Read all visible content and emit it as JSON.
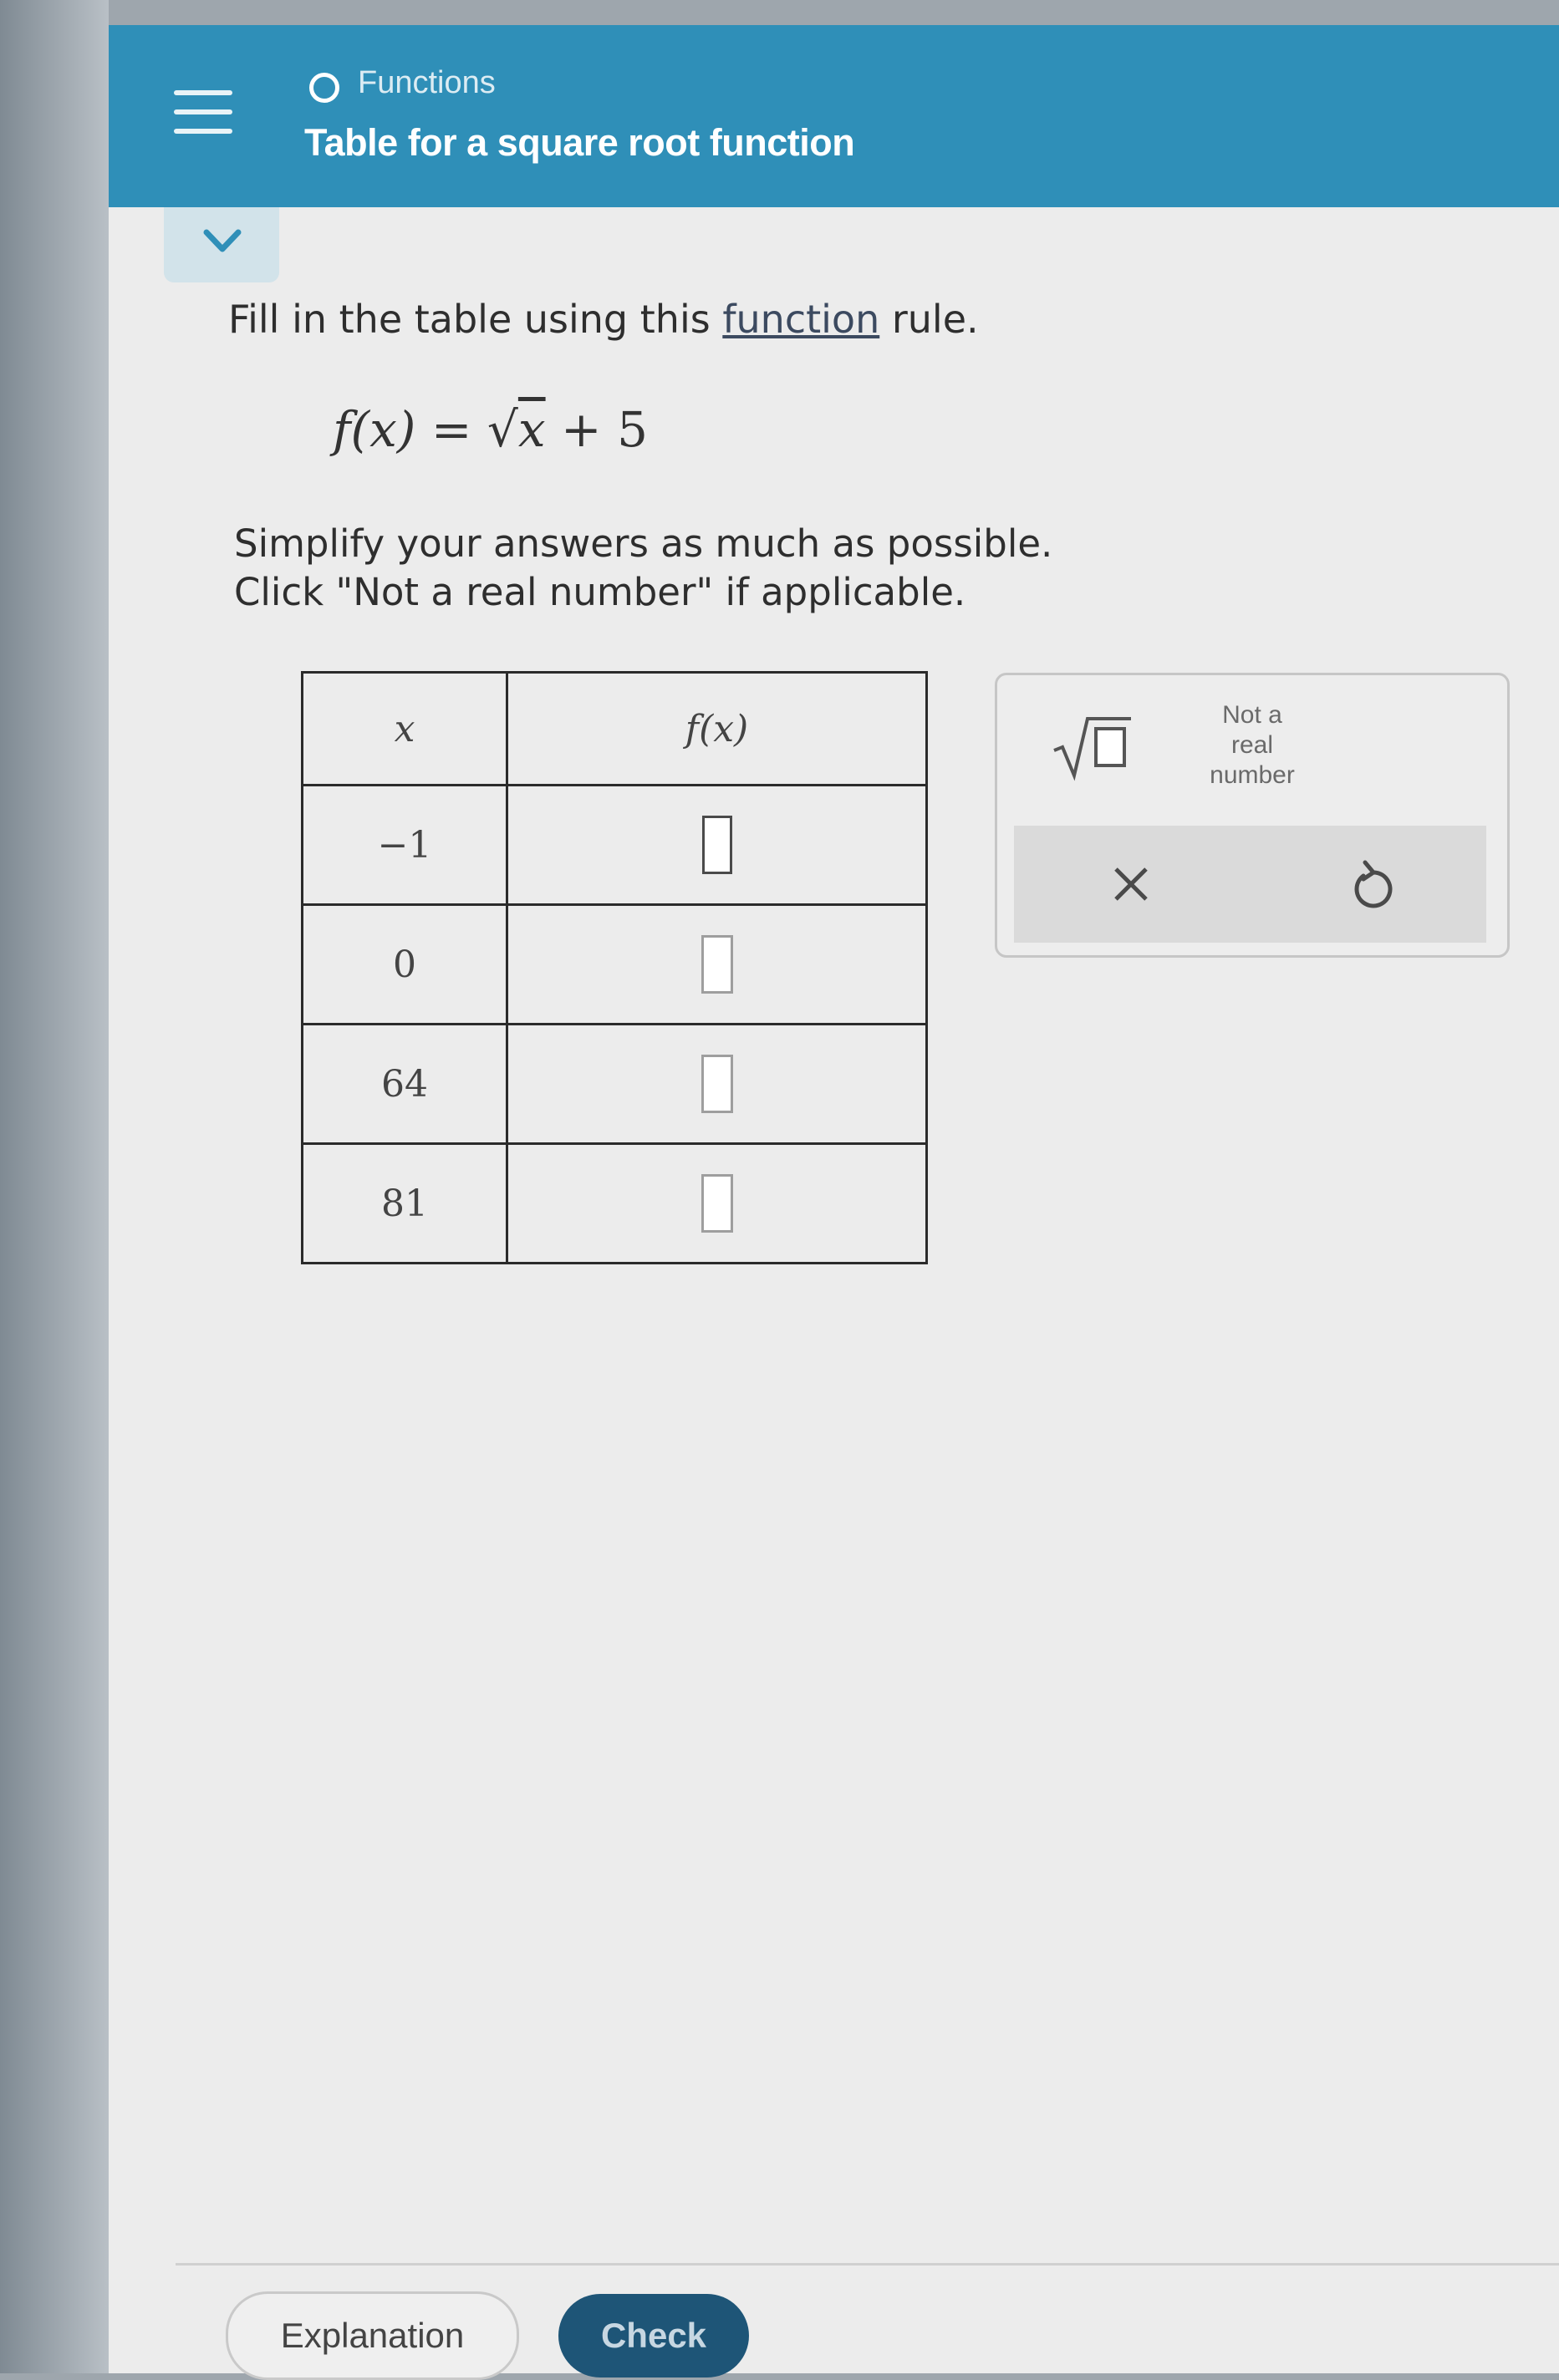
{
  "header": {
    "topic": "Functions",
    "title": "Table for a square root function",
    "color": "#2f8fb8"
  },
  "icons": {
    "menu": "menu-icon",
    "collapse": "chevron-down-icon",
    "topic": "circle-icon"
  },
  "problem": {
    "instruction_before": "Fill in the table using this ",
    "instruction_link": "function",
    "instruction_after": " rule.",
    "formula_left": "f(x) = ",
    "formula_radicand": "x",
    "formula_right": " + 5",
    "note_line1": "Simplify your answers as much as possible.",
    "note_line2": "Click \"Not a real number\" if applicable."
  },
  "table": {
    "headers": [
      "x",
      "f(x)"
    ],
    "rows": [
      {
        "x": "−1",
        "fx": ""
      },
      {
        "x": "0",
        "fx": ""
      },
      {
        "x": "64",
        "fx": ""
      },
      {
        "x": "81",
        "fx": ""
      }
    ]
  },
  "keypad": {
    "sqrt_key": "sqrt-template-icon",
    "not_real_line1": "Not a",
    "not_real_line2": "real",
    "not_real_line3": "number",
    "clear_key": "close-icon",
    "undo_key": "undo-icon"
  },
  "footer": {
    "explanation_label": "Explanation",
    "check_label": "Check",
    "check_color": "#1e5577"
  }
}
